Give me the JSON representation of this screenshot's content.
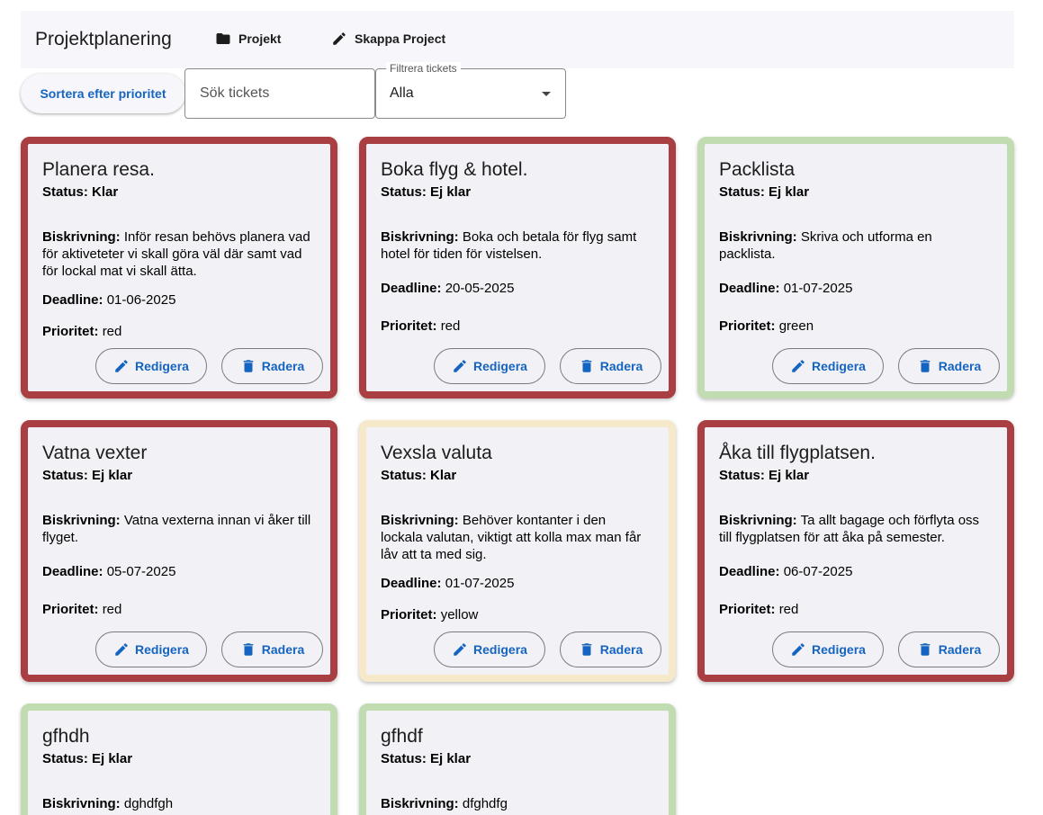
{
  "appbar": {
    "title": "Projektplanering",
    "nav": [
      {
        "label": "Projekt",
        "icon": "folder-icon"
      },
      {
        "label": "Skappa Project",
        "icon": "pencil-icon"
      }
    ]
  },
  "toolbar": {
    "sort_label": "Sortera efter prioritet",
    "search_placeholder": "Sök tickets",
    "filter_label": "Filtrera tickets",
    "filter_value": "Alla"
  },
  "labels": {
    "description": "Biskrivning:",
    "deadline": "Deadline:",
    "priority": "Prioritet:",
    "edit": "Redigera",
    "delete": "Radera"
  },
  "colors": {
    "red": "#a93f42",
    "green": "#c1dcb0",
    "yellow": "#f6e9c9",
    "accent": "#1565c0"
  },
  "cards": [
    {
      "title": "Planera resa.",
      "status": "Status: Klar",
      "description": "Inför resan behövs planera vad för aktiveteter vi skall göra väl där samt vad för lockal mat vi skall ätta.",
      "deadline": "01-06-2025",
      "priority": "red"
    },
    {
      "title": "Boka flyg & hotel.",
      "status": "Status: Ej klar",
      "description": "Boka och betala för flyg samt hotel för tiden för vistelsen.",
      "deadline": "20-05-2025",
      "priority": "red"
    },
    {
      "title": "Packlista",
      "status": "Status: Ej klar",
      "description": "Skriva och utforma en packlista.",
      "deadline": "01-07-2025",
      "priority": "green"
    },
    {
      "title": "Vatna vexter",
      "status": "Status: Ej klar",
      "description": "Vatna vexterna innan vi åker till flyget.",
      "deadline": "05-07-2025",
      "priority": "red"
    },
    {
      "title": "Vexsla valuta",
      "status": "Status: Klar",
      "description": "Behöver kontanter i den lockala valutan, viktigt att kolla max man får låv att ta med sig.",
      "deadline": "01-07-2025",
      "priority": "yellow"
    },
    {
      "title": "Åka till flygplatsen.",
      "status": "Status: Ej klar",
      "description": "Ta allt bagage och förflyta oss till flygplatsen för att åka på semester.",
      "deadline": "06-07-2025",
      "priority": "red"
    },
    {
      "title": "gfhdh",
      "status": "Status: Ej klar",
      "description": "dghdfgh",
      "deadline": "",
      "priority": "green"
    },
    {
      "title": "gfhdf",
      "status": "Status: Ej klar",
      "description": "dfghdfg",
      "deadline": "",
      "priority": "green"
    }
  ]
}
